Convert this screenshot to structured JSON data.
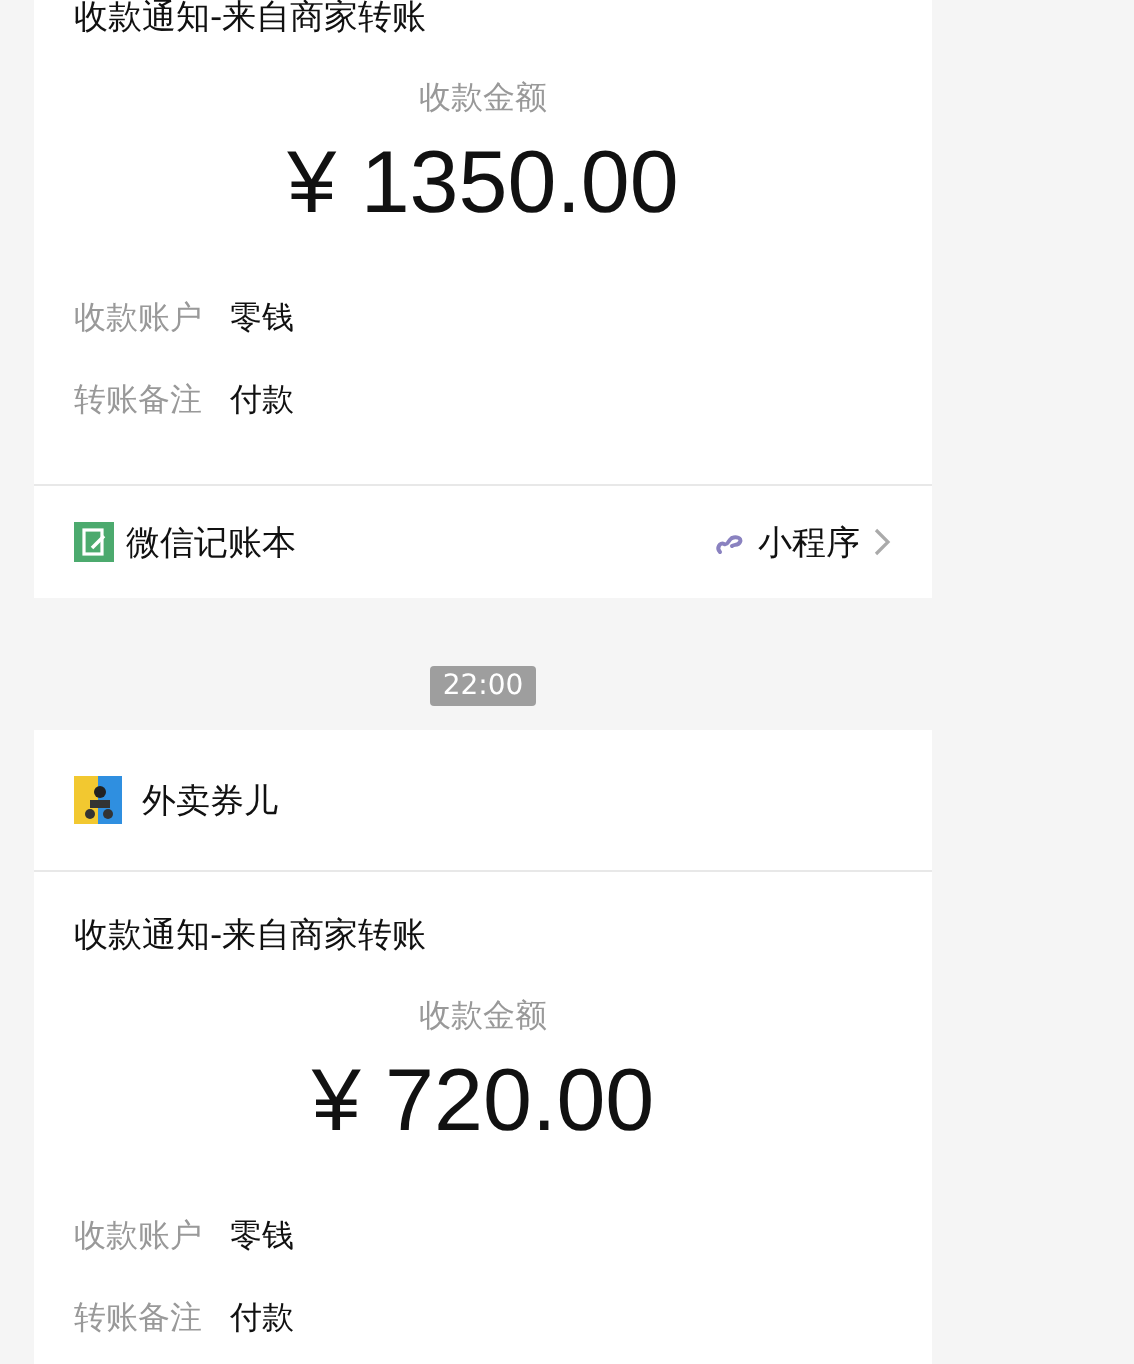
{
  "messages": [
    {
      "kind": "card",
      "title": "收款通知-来自商家转账",
      "amount_label": "收款金额",
      "amount": "¥ 1350.00",
      "fields": [
        {
          "label": "收款账户",
          "value": "零钱"
        },
        {
          "label": "转账备注",
          "value": "付款"
        }
      ],
      "footer": {
        "app": "微信记账本",
        "link": "小程序"
      }
    },
    {
      "kind": "time",
      "text": "22:00"
    },
    {
      "kind": "card",
      "header": {
        "app": "外卖券儿"
      },
      "title": "收款通知-来自商家转账",
      "amount_label": "收款金额",
      "amount": "¥ 720.00",
      "fields": [
        {
          "label": "收款账户",
          "value": "零钱"
        },
        {
          "label": "转账备注",
          "value": "付款"
        }
      ]
    }
  ]
}
